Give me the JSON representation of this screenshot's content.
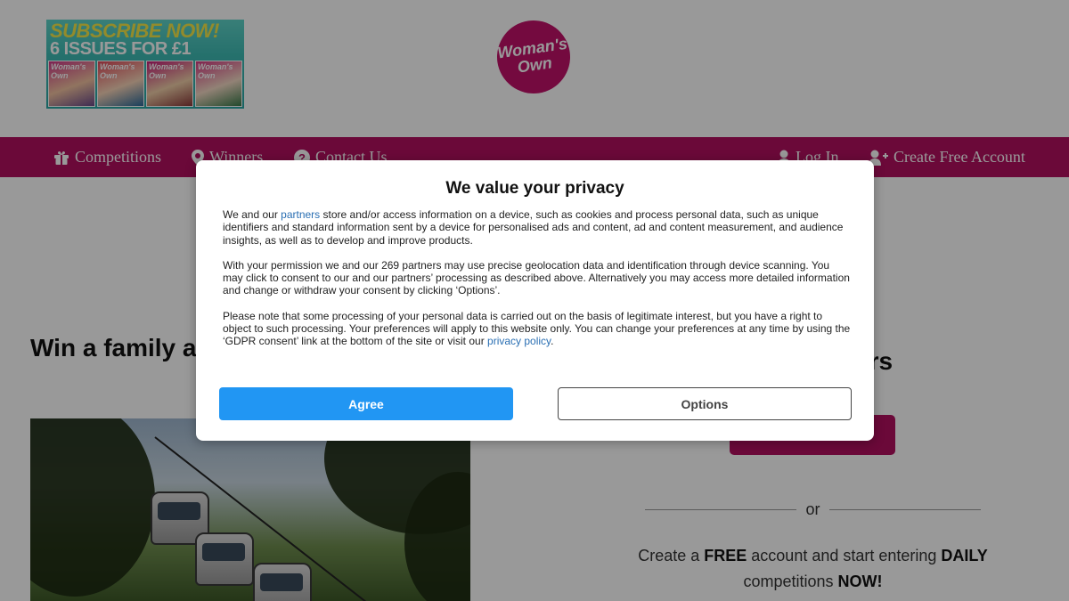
{
  "header": {
    "subscribe_line1": "SUBSCRIBE NOW!",
    "subscribe_line2": "6 ISSUES FOR £1",
    "cover_label": "Woman's Own",
    "logo_line1": "Woman's",
    "logo_line2": "Own"
  },
  "nav": {
    "competitions": "Competitions",
    "winners": "Winners",
    "contact": "Contact Us",
    "login": "Log In",
    "create_account": "Create Free Account"
  },
  "article": {
    "title": "Win a family and Abraham"
  },
  "sidebar": {
    "winners_heading": "ers",
    "or_text": "or",
    "create_prefix": "Create a ",
    "create_free": "FREE",
    "create_mid": " account and start entering ",
    "create_daily": "DAILY",
    "create_mid2": " competitions ",
    "create_now": "NOW!"
  },
  "consent": {
    "title": "We value your privacy",
    "p1_before": "We and our ",
    "p1_link": "partners",
    "p1_after": " store and/or access information on a device, such as cookies and process personal data, such as unique identifiers and standard information sent by a device for personalised ads and content, ad and content measurement, and audience insights, as well as to develop and improve products.",
    "p2": "With your permission we and our 269 partners may use precise geolocation data and identification through device scanning. You may click to consent to our and our partners’ processing as described above. Alternatively you may access more detailed information and change or withdraw your consent by clicking ‘Options’.",
    "p3_before": "Please note that some processing of your personal data is carried out on the basis of legitimate interest, but you have a right to object to such processing. Your preferences will apply to this website only. You can change your preferences at any time by using the ‘GDPR consent’ link at the bottom of the site or visit our ",
    "p3_link": "privacy policy",
    "p3_after": ".",
    "agree": "Agree",
    "options": "Options"
  },
  "colors": {
    "brand": "#b3105f",
    "agree_button": "#2196f3",
    "link": "#2a6fb3"
  }
}
